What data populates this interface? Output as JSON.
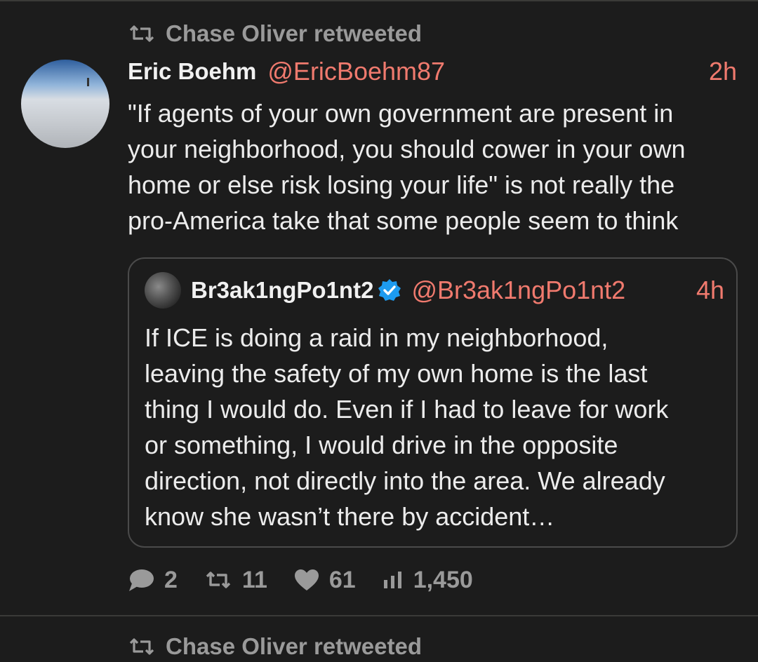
{
  "tweet": {
    "retweeted_by": "Chase Oliver retweeted",
    "author_name": "Eric Boehm",
    "author_handle": "@EricBoehm87",
    "time": "2h",
    "body_lines": [
      "\"If agents of your own government are present in",
      "your neighborhood, you should cower in your own",
      "home or else risk losing your life\" is not really the",
      "pro-America take that some people seem to think"
    ],
    "quoted": {
      "author_name": "Br3ak1ngPo1nt2",
      "author_handle": "@Br3ak1ngPo1nt2",
      "time": "4h",
      "verified": true,
      "body_lines": [
        "If ICE is doing a raid in my neighborhood,",
        "leaving the safety of my own home is the last",
        "thing I would do. Even if I had to leave for work",
        "or something, I would drive in the opposite",
        "direction, not directly into the area. We already",
        "know she wasn’t there by accident…"
      ]
    },
    "stats": {
      "replies": "2",
      "retweets": "11",
      "likes": "61",
      "views": "1,450"
    }
  },
  "next_tweet": {
    "retweeted_by": "Chase Oliver retweeted"
  },
  "colors": {
    "background": "#1c1c1c",
    "accent": "#f07a6e",
    "muted": "#9a9a9a",
    "verified": "#1d9bf0"
  }
}
